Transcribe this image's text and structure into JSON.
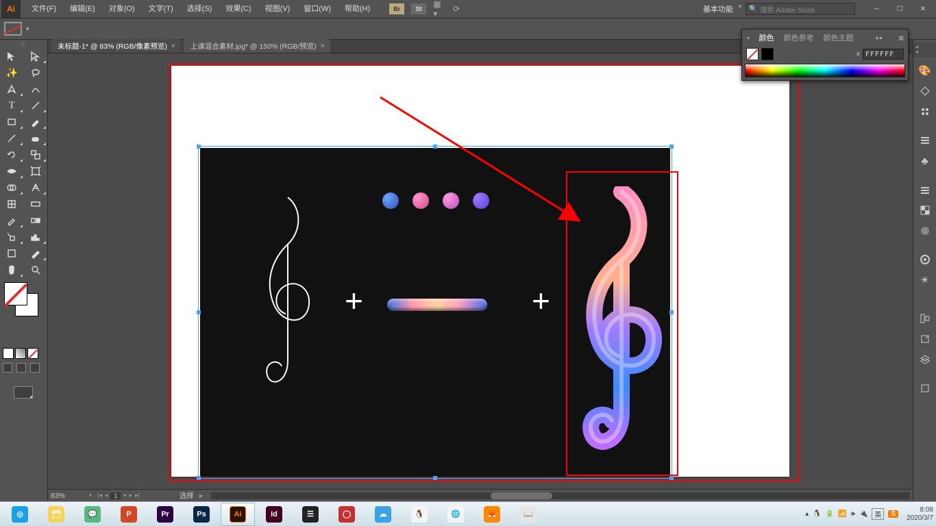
{
  "menubar": {
    "items": [
      "文件(F)",
      "编辑(E)",
      "对象(O)",
      "文字(T)",
      "选择(S)",
      "效果(C)",
      "视图(V)",
      "窗口(W)",
      "帮助(H)"
    ],
    "util_buttons": [
      "Br",
      "St"
    ],
    "workspace_label": "基本功能",
    "stock_placeholder": "搜索 Adobe Stock"
  },
  "tabs": [
    {
      "label": "未标题-1* @ 83% (RGB/像素预览)",
      "active": true
    },
    {
      "label": "上课混合素材.jpg* @ 150% (RGB/预览)",
      "active": false
    }
  ],
  "statusbar": {
    "zoom": "83%",
    "artboard_index": "1",
    "selection_label": "选择"
  },
  "color_panel": {
    "tabs": [
      "颜色",
      "颜色参考",
      "颜色主题"
    ],
    "hex": "FFFFFF",
    "hash": "#"
  },
  "taskbar": {
    "apps": [
      {
        "name": "360-browser",
        "bg": "#1aa0e8",
        "txt": "◎"
      },
      {
        "name": "explorer",
        "bg": "#f7d35a",
        "txt": "🗂"
      },
      {
        "name": "wechat",
        "bg": "#57b97f",
        "txt": "💬"
      },
      {
        "name": "powerpoint",
        "bg": "#d24726",
        "txt": "P"
      },
      {
        "name": "premiere",
        "bg": "#2a0043",
        "txt": "Pr"
      },
      {
        "name": "photoshop",
        "bg": "#0a2749",
        "txt": "Ps"
      },
      {
        "name": "illustrator",
        "bg": "#2b1100",
        "txt": "Ai",
        "active": true
      },
      {
        "name": "indesign",
        "bg": "#40001e",
        "txt": "Id"
      },
      {
        "name": "misc1",
        "bg": "#222",
        "txt": "☰"
      },
      {
        "name": "misc2",
        "bg": "#c73030",
        "txt": "◯"
      },
      {
        "name": "misc3",
        "bg": "#3aa3e3",
        "txt": "☁"
      },
      {
        "name": "qq",
        "bg": "#f5f5f5",
        "txt": "🐧"
      },
      {
        "name": "chrome",
        "bg": "#f5f5f5",
        "txt": "🌐"
      },
      {
        "name": "firefox",
        "bg": "#ff8a00",
        "txt": "🦊"
      },
      {
        "name": "notes",
        "bg": "#e6e6e6",
        "txt": "📖"
      }
    ],
    "tray_icons": [
      "▴",
      "🐧",
      "🔋",
      "📶",
      "🕪",
      "🔌"
    ],
    "ime1": "英",
    "ime2": "S",
    "time": "8:08",
    "date": "2020/3/7"
  }
}
